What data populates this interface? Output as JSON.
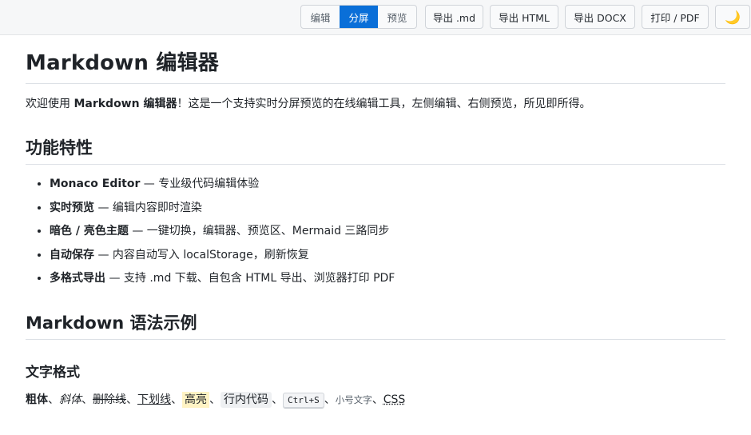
{
  "toolbar": {
    "view_modes": [
      "编辑",
      "分屏",
      "预览"
    ],
    "active_mode": "分屏",
    "export_md": "导出 .md",
    "export_html": "导出 HTML",
    "export_docx": "导出 DOCX",
    "print_pdf": "打印 / PDF",
    "theme_icon": "moon-icon",
    "theme_glyph": "🌙"
  },
  "doc": {
    "title": "Markdown 编辑器",
    "intro": {
      "prefix": "欢迎使用 ",
      "bold": "Markdown 编辑器",
      "suffix": "！这是一个支持实时分屏预览的在线编辑工具，左侧编辑、右侧预览，所见即所得。"
    },
    "features_heading": "功能特性",
    "features": [
      {
        "name": "Monaco Editor",
        "desc": " — 专业级代码编辑体验"
      },
      {
        "name": "实时预览",
        "desc": " — 编辑内容即时渲染"
      },
      {
        "name": "暗色 / 亮色主题",
        "desc": " — 一键切换，编辑器、预览区、Mermaid 三路同步"
      },
      {
        "name": "自动保存",
        "desc": " — 内容自动写入 localStorage，刷新恢复"
      },
      {
        "name": "多格式导出",
        "desc": " — 支持 .md 下载、自包含 HTML 导出、浏览器打印 PDF"
      }
    ],
    "syntax_heading": "Markdown 语法示例",
    "text_format_heading": "文字格式",
    "format": {
      "bold": "粗体",
      "italic": "斜体",
      "strike": "删除线",
      "underline": "下划线",
      "highlight": "高亮",
      "inline_code": "行内代码",
      "kbd": "Ctrl+S",
      "small": "小号文字",
      "abbr": "CSS",
      "sep": "、"
    }
  },
  "colors": {
    "accent": "#0a6fd8",
    "highlight_bg": "#fff3c4"
  }
}
